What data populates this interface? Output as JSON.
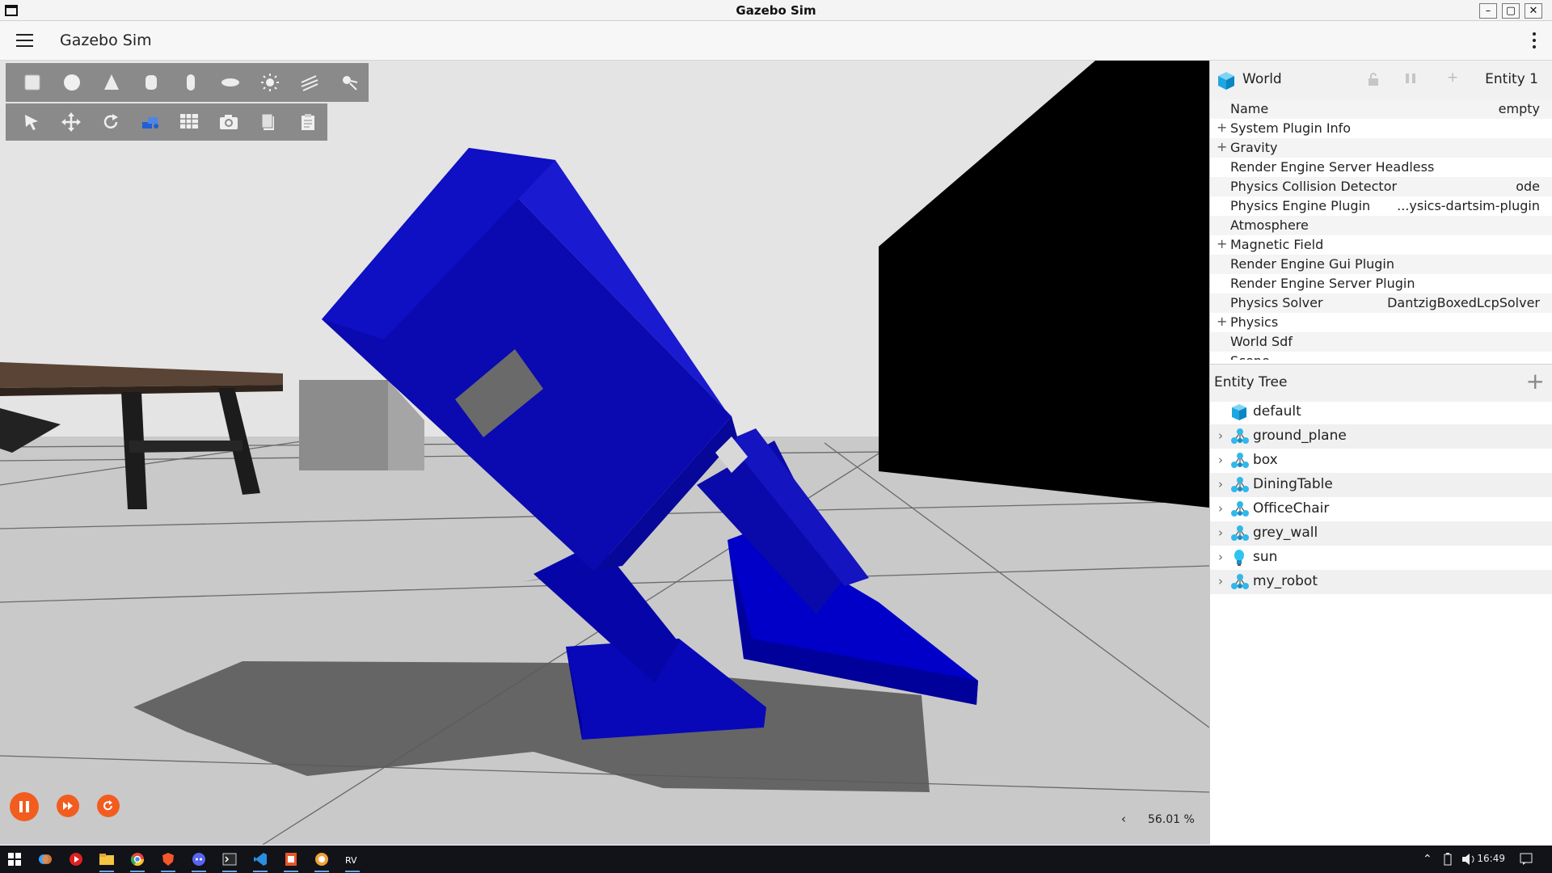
{
  "window": {
    "title": "Gazebo Sim",
    "controls": [
      "minimize",
      "maximize",
      "close"
    ]
  },
  "header": {
    "app_title": "Gazebo Sim",
    "menu_icon": "hamburger-menu-icon",
    "options_icon": "kebab-menu-icon"
  },
  "toolbar_shapes": [
    {
      "name": "box-icon",
      "label": "Box"
    },
    {
      "name": "sphere-icon",
      "label": "Sphere"
    },
    {
      "name": "cone-icon",
      "label": "Cone"
    },
    {
      "name": "cylinder-icon",
      "label": "Cylinder"
    },
    {
      "name": "capsule-icon",
      "label": "Capsule"
    },
    {
      "name": "ellipsoid-icon",
      "label": "Ellipsoid"
    },
    {
      "name": "point-light-icon",
      "label": "Point light"
    },
    {
      "name": "directional-light-icon",
      "label": "Directional light"
    },
    {
      "name": "spot-light-icon",
      "label": "Spot light"
    }
  ],
  "toolbar_tools": [
    {
      "name": "select-icon",
      "label": "Select"
    },
    {
      "name": "translate-icon",
      "label": "Translate"
    },
    {
      "name": "rotate-icon",
      "label": "Rotate"
    },
    {
      "name": "view-angle-icon",
      "label": "View angle"
    },
    {
      "name": "grid-icon",
      "label": "Grid"
    },
    {
      "name": "screenshot-icon",
      "label": "Screenshot"
    },
    {
      "name": "copy-icon",
      "label": "Copy"
    },
    {
      "name": "paste-icon",
      "label": "Paste"
    }
  ],
  "playback": {
    "pause_icon": "pause-icon",
    "step_icon": "step-forward-icon",
    "reset_icon": "reset-icon"
  },
  "viewport": {
    "real_time_factor": "56.01 %",
    "expand_icon": "chevron-left-icon"
  },
  "component_inspector": {
    "title": "World",
    "entity_label": "Entity 1",
    "rows": [
      {
        "label": "Name",
        "value": "empty",
        "expandable": false
      },
      {
        "label": "System Plugin Info",
        "value": "",
        "expandable": true
      },
      {
        "label": "Gravity",
        "value": "",
        "expandable": true
      },
      {
        "label": "Render Engine Server Headless",
        "value": "",
        "expandable": false
      },
      {
        "label": "Physics Collision Detector",
        "value": "ode",
        "expandable": false
      },
      {
        "label": "Physics Engine Plugin",
        "value": "...ysics-dartsim-plugin",
        "expandable": false
      },
      {
        "label": "Atmosphere",
        "value": "",
        "expandable": false
      },
      {
        "label": "Magnetic Field",
        "value": "",
        "expandable": true
      },
      {
        "label": "Render Engine Gui Plugin",
        "value": "",
        "expandable": false
      },
      {
        "label": "Render Engine Server Plugin",
        "value": "",
        "expandable": false
      },
      {
        "label": "Physics Solver",
        "value": "DantzigBoxedLcpSolver",
        "expandable": false
      },
      {
        "label": "Physics",
        "value": "",
        "expandable": true
      },
      {
        "label": "World Sdf",
        "value": "",
        "expandable": false
      },
      {
        "label": "Scene",
        "value": "",
        "expandable": false
      }
    ]
  },
  "entity_tree": {
    "title": "Entity Tree",
    "items": [
      {
        "name": "default",
        "icon": "world-icon",
        "expandable": false
      },
      {
        "name": "ground_plane",
        "icon": "model-icon",
        "expandable": true
      },
      {
        "name": "box",
        "icon": "model-icon",
        "expandable": true
      },
      {
        "name": "DiningTable",
        "icon": "model-icon",
        "expandable": true
      },
      {
        "name": "OfficeChair",
        "icon": "model-icon",
        "expandable": true
      },
      {
        "name": "grey_wall",
        "icon": "model-icon",
        "expandable": true
      },
      {
        "name": "sun",
        "icon": "light-icon",
        "expandable": true
      },
      {
        "name": "my_robot",
        "icon": "model-icon",
        "expandable": true
      }
    ]
  },
  "taskbar": {
    "time": "16:49",
    "apps": [
      "windows-start-icon",
      "copilot-icon",
      "youtube-icon",
      "file-explorer-icon",
      "chrome-icon",
      "brave-icon",
      "discord-icon",
      "terminal-icon",
      "vscode-icon",
      "app-icon",
      "gazebo-icon",
      "rviz-icon"
    ]
  },
  "colors": {
    "accent": "#f25c1f",
    "robot_blue": "#0a0aa8",
    "toolbar_bg": "#8a8a8a"
  }
}
